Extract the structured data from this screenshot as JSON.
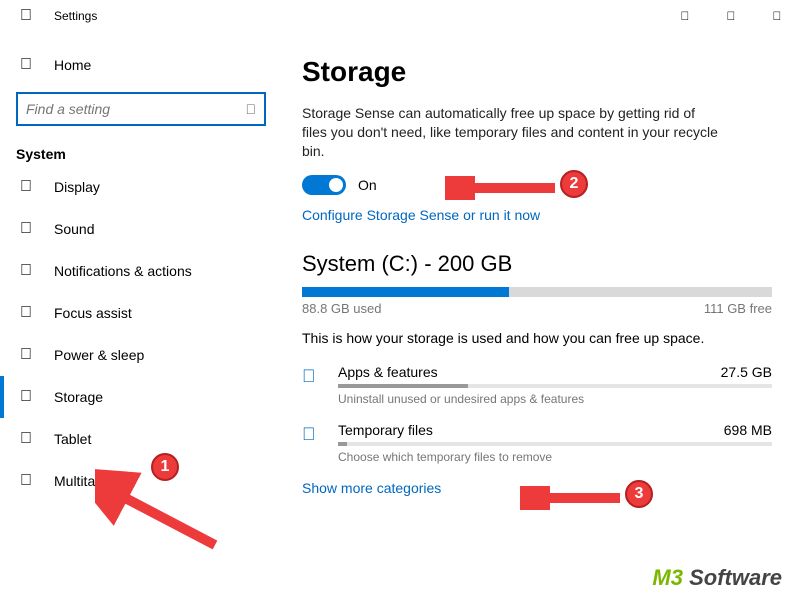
{
  "window": {
    "title": "Settings"
  },
  "sidebar": {
    "home": "Home",
    "search_placeholder": "Find a setting",
    "group": "System",
    "items": [
      {
        "icon": "display-icon",
        "glyph": "",
        "label": "Display"
      },
      {
        "icon": "sound-icon",
        "glyph": "",
        "label": "Sound"
      },
      {
        "icon": "notify-icon",
        "glyph": "",
        "label": "Notifications & actions"
      },
      {
        "icon": "focus-icon",
        "glyph": "",
        "label": "Focus assist"
      },
      {
        "icon": "power-icon",
        "glyph": "",
        "label": "Power & sleep"
      },
      {
        "icon": "storage-icon",
        "glyph": "",
        "label": "Storage",
        "selected": true
      },
      {
        "icon": "tablet-icon",
        "glyph": "",
        "label": "Tablet"
      },
      {
        "icon": "multitask-icon",
        "glyph": "",
        "label": "Multitasking"
      }
    ]
  },
  "main": {
    "heading": "Storage",
    "description": "Storage Sense can automatically free up space by getting rid of files you don't need, like temporary files and content in your recycle bin.",
    "toggle_state": "On",
    "configure_link": "Configure Storage Sense or run it now",
    "drive_heading": "System (C:) - 200 GB",
    "used_label": "88.8 GB used",
    "free_label": "111 GB free",
    "used_pct": 44,
    "how_text": "This is how your storage is used and how you can free up space.",
    "categories": [
      {
        "icon": "apps-icon",
        "glyph": "",
        "name": "Apps & features",
        "size": "27.5 GB",
        "sub": "Uninstall unused or undesired apps & features",
        "pct": 30
      },
      {
        "icon": "trash-icon",
        "glyph": "",
        "name": "Temporary files",
        "size": "698 MB",
        "sub": "Choose which temporary files to remove",
        "pct": 2
      }
    ],
    "show_more": "Show more categories"
  },
  "annotations": {
    "badge1": "1",
    "badge2": "2",
    "badge3": "3"
  },
  "watermark": {
    "m3": "M3",
    "sw": " Software"
  }
}
